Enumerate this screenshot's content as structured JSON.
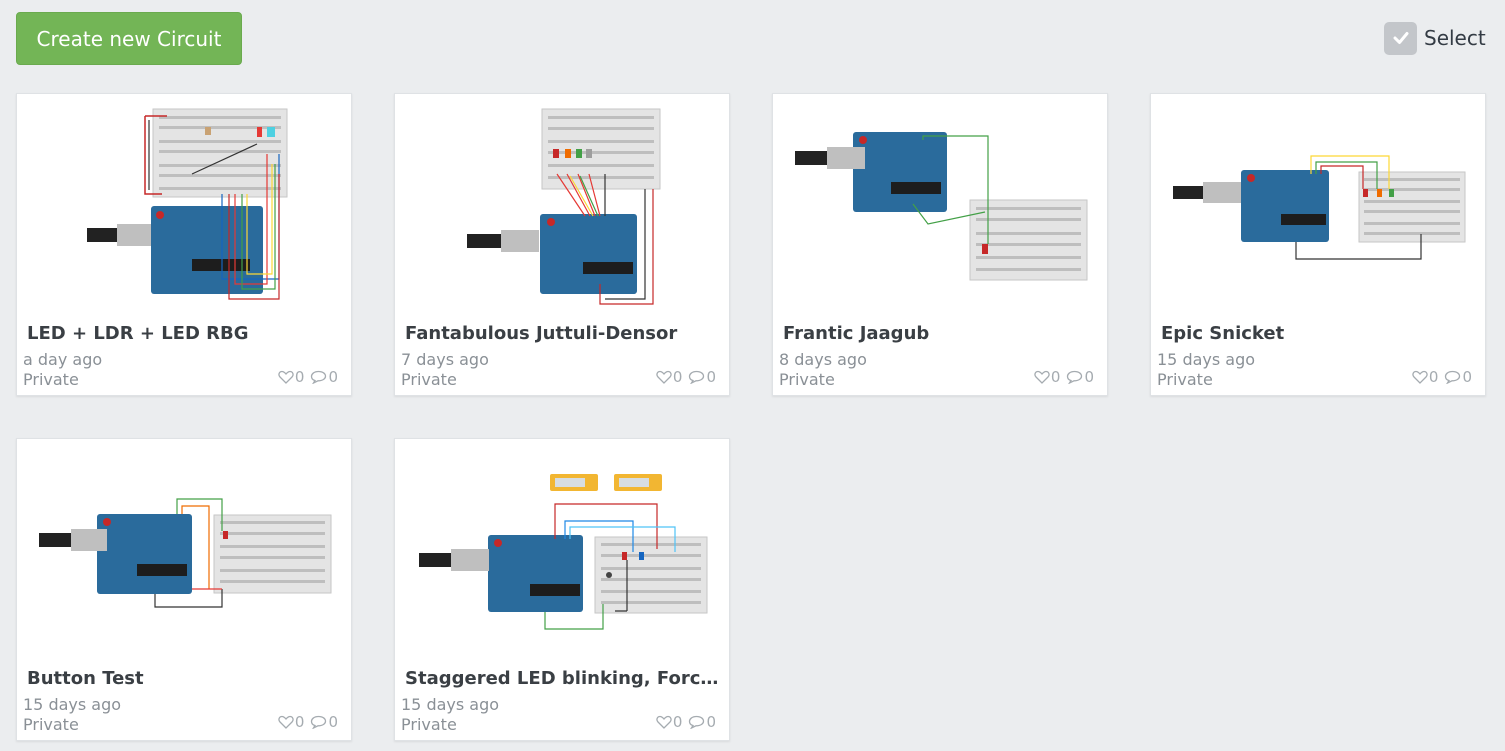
{
  "toolbar": {
    "create_label": "Create new Circuit",
    "select_label": "Select"
  },
  "colors": {
    "create_button": "#73b556",
    "page_bg": "#ebedef",
    "arduino_blue": "#2a6b9c"
  },
  "cards": [
    {
      "title": "LED + LDR + LED RBG",
      "date": "a day ago",
      "visibility": "Private",
      "likes": "0",
      "comments": "0"
    },
    {
      "title": "Fantabulous Juttuli-Densor",
      "date": "7 days ago",
      "visibility": "Private",
      "likes": "0",
      "comments": "0"
    },
    {
      "title": "Frantic Jaagub",
      "date": "8 days ago",
      "visibility": "Private",
      "likes": "0",
      "comments": "0"
    },
    {
      "title": "Epic Snicket",
      "date": "15 days ago",
      "visibility": "Private",
      "likes": "0",
      "comments": "0"
    },
    {
      "title": "Button Test",
      "date": "15 days ago",
      "visibility": "Private",
      "likes": "0",
      "comments": "0"
    },
    {
      "title": "Staggered LED blinking, Forced ...",
      "date": "15 days ago",
      "visibility": "Private",
      "likes": "0",
      "comments": "0"
    }
  ]
}
